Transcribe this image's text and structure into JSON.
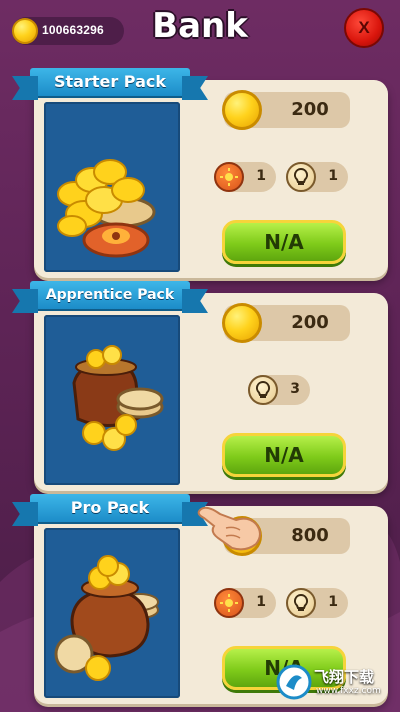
{
  "header": {
    "coins": "100663296",
    "title": "Bank",
    "close_label": "X"
  },
  "packs": [
    {
      "name": "Starter Pack",
      "coins": "200",
      "items": [
        {
          "icon": "sun-token-icon",
          "count": "1"
        },
        {
          "icon": "lightbulb-icon",
          "count": "1"
        }
      ],
      "button": "N/A"
    },
    {
      "name": "Apprentice Pack",
      "coins": "200",
      "items": [
        {
          "icon": "lightbulb-icon",
          "count": "3"
        }
      ],
      "button": "N/A"
    },
    {
      "name": "Pro Pack",
      "coins": "800",
      "items": [
        {
          "icon": "sun-token-icon",
          "count": "1"
        },
        {
          "icon": "lightbulb-icon",
          "count": "1"
        }
      ],
      "button": "N/A"
    }
  ],
  "watermark": {
    "text": "飞翔下载",
    "sub": "www.fxxz.com"
  },
  "colors": {
    "background": "#5e2456",
    "card": "#f3ead8",
    "ribbon": "#1c8cc8",
    "button": "#7fcb1a",
    "coin": "#ffd21c"
  }
}
